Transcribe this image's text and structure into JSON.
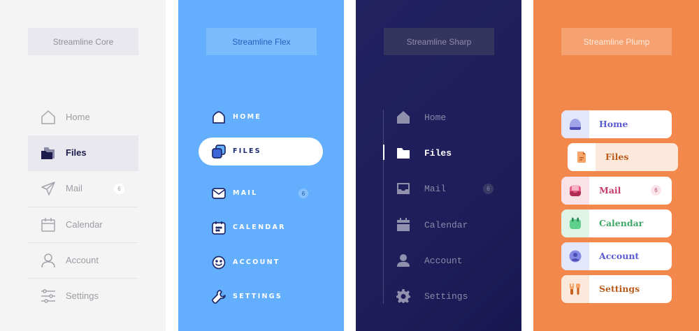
{
  "colors": {
    "core_bg": "#f4f4f5",
    "flex_bg": "#64affd",
    "sharp_bg": "#201f5c",
    "plump_bg": "#f2884b"
  },
  "core": {
    "title": "Streamline Core",
    "items": [
      {
        "label": "Home",
        "icon": "home-icon"
      },
      {
        "label": "Files",
        "icon": "folder-icon",
        "active": true
      },
      {
        "label": "Mail",
        "icon": "send-icon",
        "badge": "6"
      },
      {
        "label": "Calendar",
        "icon": "calendar-icon"
      },
      {
        "label": "Account",
        "icon": "user-icon"
      },
      {
        "label": "Settings",
        "icon": "sliders-icon"
      }
    ]
  },
  "flex": {
    "title": "Streamline Flex",
    "items": [
      {
        "label": "HOME",
        "icon": "home-icon"
      },
      {
        "label": "FILES",
        "icon": "files-icon",
        "active": true
      },
      {
        "label": "MAIL",
        "icon": "mail-icon",
        "badge": "6"
      },
      {
        "label": "CALENDAR",
        "icon": "calendar-icon"
      },
      {
        "label": "ACCOUNT",
        "icon": "smiley-icon"
      },
      {
        "label": "SETTINGS",
        "icon": "wrench-icon"
      }
    ]
  },
  "sharp": {
    "title": "Streamline Sharp",
    "items": [
      {
        "label": "Home",
        "icon": "home-icon"
      },
      {
        "label": "Files",
        "icon": "folder-icon",
        "active": true
      },
      {
        "label": "Mail",
        "icon": "inbox-icon",
        "badge": "6"
      },
      {
        "label": "Calendar",
        "icon": "calendar-icon"
      },
      {
        "label": "Account",
        "icon": "user-icon"
      },
      {
        "label": "Settings",
        "icon": "gear-icon"
      }
    ]
  },
  "plump": {
    "title": "Streamline Plump",
    "items": [
      {
        "label": "Home",
        "icon": "home-icon",
        "color": "#5b5bd0"
      },
      {
        "label": "Files",
        "icon": "document-icon",
        "color": "#b85a1c",
        "active": true
      },
      {
        "label": "Mail",
        "icon": "inbox-icon",
        "color": "#c73d67",
        "badge": "6"
      },
      {
        "label": "Calendar",
        "icon": "calendar-icon",
        "color": "#3fa768"
      },
      {
        "label": "Account",
        "icon": "user-icon",
        "color": "#5b5bd0"
      },
      {
        "label": "Settings",
        "icon": "tools-icon",
        "color": "#b85a1c"
      }
    ]
  }
}
